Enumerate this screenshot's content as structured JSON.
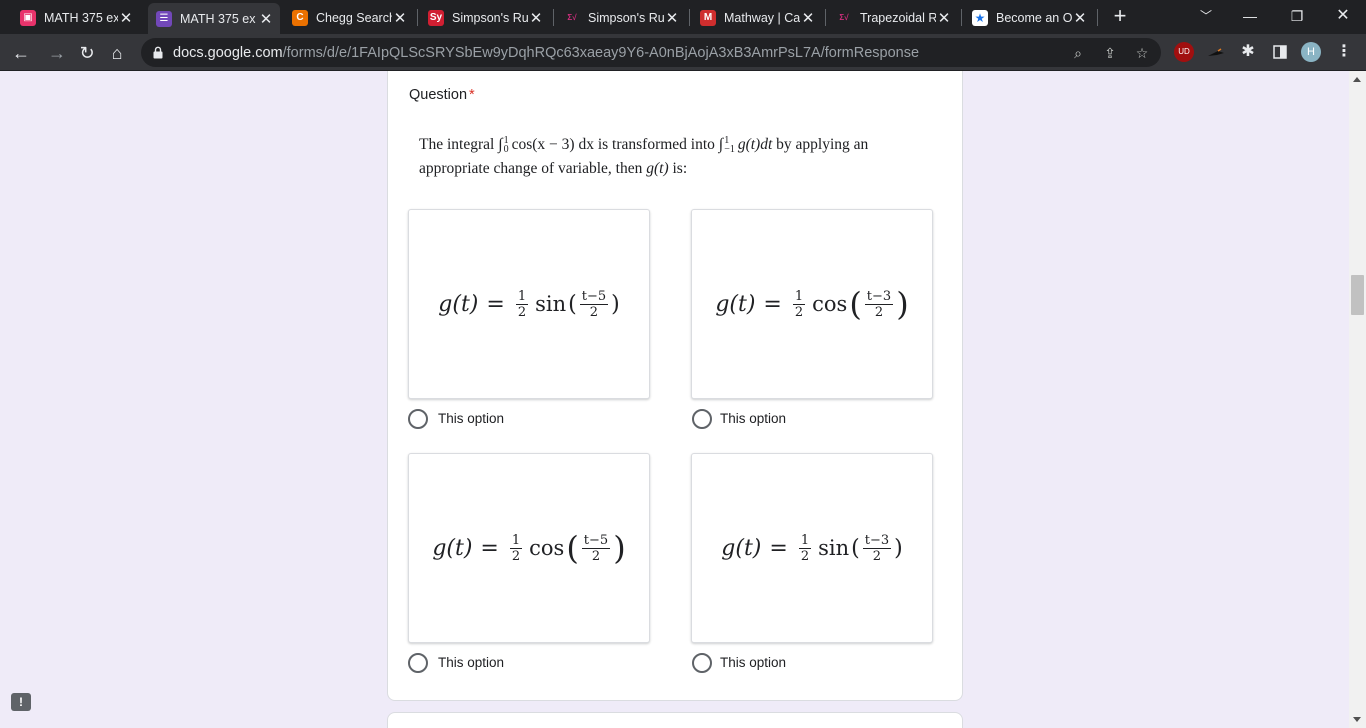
{
  "browser": {
    "tabs": [
      {
        "title": "MATH 375 ex",
        "icon": "google-classroom-icon",
        "icon_color": "#e8336b",
        "active": false
      },
      {
        "title": "MATH 375 ex",
        "icon": "google-forms-icon",
        "icon_color": "#7248b9",
        "active": true
      },
      {
        "title": "Chegg Search",
        "icon": "chegg-icon",
        "icon_color": "#eb7100",
        "active": false
      },
      {
        "title": "Simpson's Ru",
        "icon": "symbolab-icon",
        "icon_color": "#d11f32",
        "active": false
      },
      {
        "title": "Simpson's Ru",
        "icon": "emath-icon",
        "icon_color": "#cf2e7d",
        "active": false
      },
      {
        "title": "Mathway | Ca",
        "icon": "mathway-icon",
        "icon_color": "#cf2e2e",
        "active": false
      },
      {
        "title": "Trapezoidal R",
        "icon": "emath-icon",
        "icon_color": "#cf2e7d",
        "active": false
      },
      {
        "title": "Become an O",
        "icon": "star-icon",
        "icon_color": "#1a73e8",
        "active": false
      }
    ],
    "address": {
      "host": "docs.google.com",
      "path": "/forms/d/e/1FAIpQLScSRYSbEw9yDqhRQc63xaeay9Y6-A0nBjAojA3xB3AmrPsL7A/formResponse"
    },
    "profile_initial": "H",
    "extension_badge": "UD"
  },
  "form": {
    "question_label": "Question",
    "required_mark": "*",
    "question": {
      "prefix": "The integral",
      "int1_upper": "1",
      "int1_lower": "0",
      "integrand1": "cos(x − 3) dx",
      "mid": "is transformed into",
      "int2_upper": "1",
      "int2_lower": "−1",
      "integrand2": "g(t)dt",
      "suffix": "by applying an",
      "line2": "appropriate  change of variable, then",
      "line2_var": "g(t)",
      "line2_end": "is:"
    },
    "options": [
      {
        "lhs": "g(t)",
        "coef_num": "1",
        "coef_den": "2",
        "func": "sin",
        "arg_num": "t−5",
        "arg_den": "2",
        "label": "This option"
      },
      {
        "lhs": "g(t)",
        "coef_num": "1",
        "coef_den": "2",
        "func": "cos",
        "arg_num": "t−3",
        "arg_den": "2",
        "label": "This option"
      },
      {
        "lhs": "g(t)",
        "coef_num": "1",
        "coef_den": "2",
        "func": "cos",
        "arg_num": "t−5",
        "arg_den": "2",
        "label": "This option"
      },
      {
        "lhs": "g(t)",
        "coef_num": "1",
        "coef_den": "2",
        "func": "sin",
        "arg_num": "t−3",
        "arg_den": "2",
        "label": "This option"
      }
    ]
  },
  "colors": {
    "page_bg": "#efebf8",
    "required": "#d93025",
    "tab_strip": "#202124",
    "toolbar": "#35363a"
  }
}
